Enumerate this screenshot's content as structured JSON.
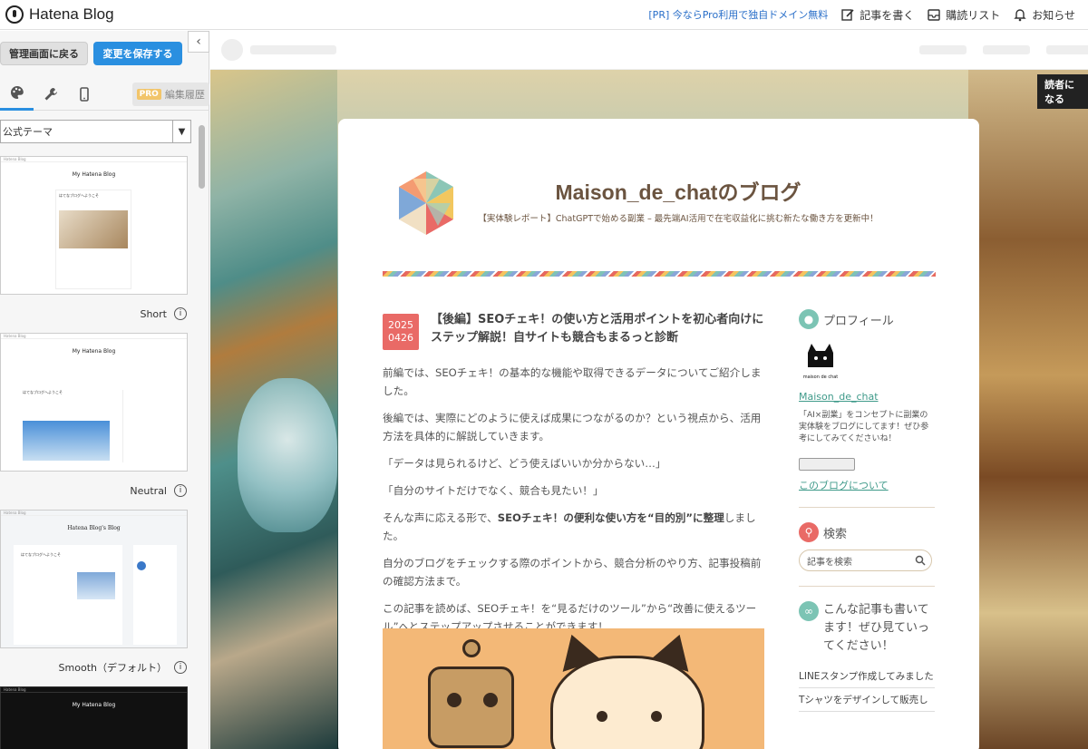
{
  "topbar": {
    "logo_text": "Hatena Blog",
    "promo": "[PR] 今ならPro利用で独自ドメイン無料",
    "write_label": "記事を書く",
    "reading_label": "購読リスト",
    "notify_label": "お知らせ"
  },
  "left": {
    "back_button": "管理画面に戻る",
    "save_button": "変更を保存する",
    "pro_badge": "PRO",
    "history_label": "編集履歴",
    "theme_select": "公式テーマ",
    "themes": [
      {
        "label": "Short",
        "mini_title": "My Hatena Blog",
        "mini_post": "はてなブログへようこそ"
      },
      {
        "label": "Neutral",
        "mini_title": "My Hatena Blog",
        "mini_post": "はてなブログへようこそ"
      },
      {
        "label": "Smooth（デフォルト）",
        "mini_title": "Hatena Blog's Blog",
        "mini_post": "はてなブログへようこそ"
      },
      {
        "label": "",
        "mini_title": "My Hatena Blog",
        "mini_post": ""
      }
    ]
  },
  "preview": {
    "reader_badge": "読者になる",
    "blog_title": "Maison_de_chatのブログ",
    "blog_desc": "【実体験レポート】ChatGPTで始める副業 – 最先端AI活用で在宅収益化に挑む新たな働き方を更新中！",
    "date_year": "2025",
    "date_md": "0426",
    "post_title": "【後編】SEOチェキ！の使い方と活用ポイントを初心者向けにステップ解説！自サイトも競合もまるっと診断",
    "paragraphs": [
      "前編では、SEOチェキ！の基本的な機能や取得できるデータについてご紹介しました。",
      "後編では、実際にどのように使えば成果につながるのか？という視点から、活用方法を具体的に解説していきます。",
      "「データは見られるけど、どう使えばいいか分からない…」",
      "「自分のサイトだけでなく、競合も見たい！」"
    ],
    "p5_pre": "そんな声に応える形で、",
    "p5_bold": "SEOチェキ！の便利な使い方を“目的別”に整理",
    "p5_post": "しました。",
    "p6": "自分のブログをチェックする際のポイントから、競合分析のやり方、記事投稿前の確認方法まで。",
    "p7": "この記事を読めば、SEOチェキ！を“見るだけのツール”から“改善に使えるツール”へとステップアップさせることができます！",
    "sidebar": {
      "profile_head": "プロフィール",
      "username": "Maison_de_chat",
      "avatar_caption": "maison de chat",
      "profile_text": "「AI×副業」をコンセプトに副業の実体験をブログにしてます！ぜひ参考にしてみてくださいね！",
      "about_link": "このブログについて",
      "search_head": "検索",
      "search_placeholder": "記事を検索",
      "more_head": "こんな記事も書いてます！ぜひ見ていってください！",
      "more_items": [
        "LINEスタンプ作成してみました",
        "Tシャツをデザインして販売し"
      ]
    }
  },
  "colors": {
    "accent_blue": "#2a8fe0",
    "date_badge": "#e96a66",
    "link_teal": "#3f9a8a",
    "title_brown": "#6b5440"
  }
}
